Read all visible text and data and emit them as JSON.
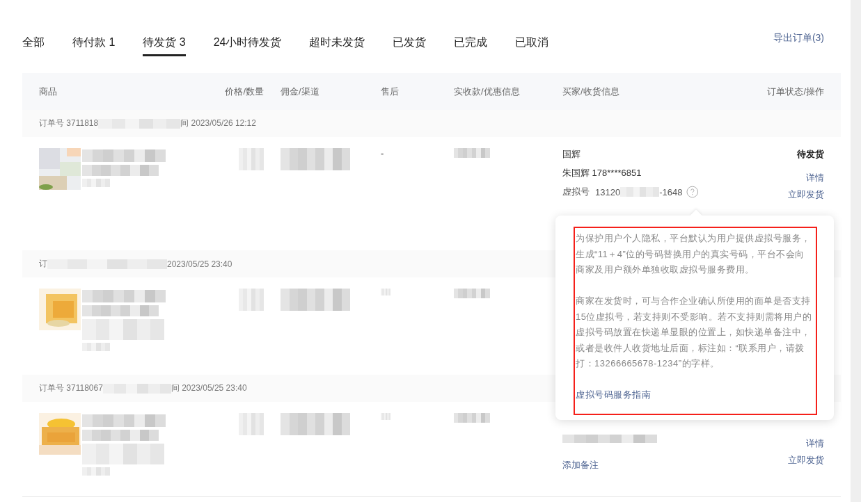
{
  "tabs": [
    {
      "label": "全部",
      "selected": false
    },
    {
      "label": "待付款 1",
      "selected": false
    },
    {
      "label": "待发货 3",
      "selected": true
    },
    {
      "label": "24小时待发货",
      "selected": false
    },
    {
      "label": "超时未发货",
      "selected": false
    },
    {
      "label": "已发货",
      "selected": false
    },
    {
      "label": "已完成",
      "selected": false
    },
    {
      "label": "已取消",
      "selected": false
    }
  ],
  "export_link": "导出订单(3)",
  "table": {
    "columns": [
      "商品",
      "价格/数量",
      "佣金/渠道",
      "售后",
      "实收款/优惠信息",
      "买家/收货信息",
      "订单状态/操作"
    ]
  },
  "orders": [
    {
      "order_no": "订单号 3711818",
      "time": "间 2023/05/26 12:12",
      "after_sale": "-",
      "buyer": {
        "name": "国辉",
        "phone": "朱国辉 178****6851",
        "virtual_label": "虚拟号",
        "virtual_prefix": "13120",
        "virtual_suffix": "-1648"
      },
      "status": "待发货",
      "actions": [
        "详情",
        "立即发货"
      ]
    },
    {
      "order_no": "订",
      "time": "2023/05/25 23:40"
    },
    {
      "order_no": "订单号 37118067",
      "time": "间 2023/05/25 23:40",
      "note_link": "添加备注",
      "actions": [
        "详情",
        "立即发货"
      ]
    }
  ],
  "popover": {
    "paragraphs": [
      "为保护用户个人隐私，平台默认为用户提供虚拟号服务，生成“11＋4”位的号码替换用户的真实号码，平台不会向商家及用户额外单独收取虚拟号服务费用。",
      "商家在发货时，可与合作企业确认所使用的面单是否支持15位虚拟号，若支持则不受影响。若不支持则需将用户的虚拟号码放置在快递单显眼的位置上，如快递单备注中，或者是收件人收货地址后面，标注如：“联系用户，请拨打：13266665678-1234”的字样。"
    ],
    "link": "虚拟号码服务指南"
  }
}
